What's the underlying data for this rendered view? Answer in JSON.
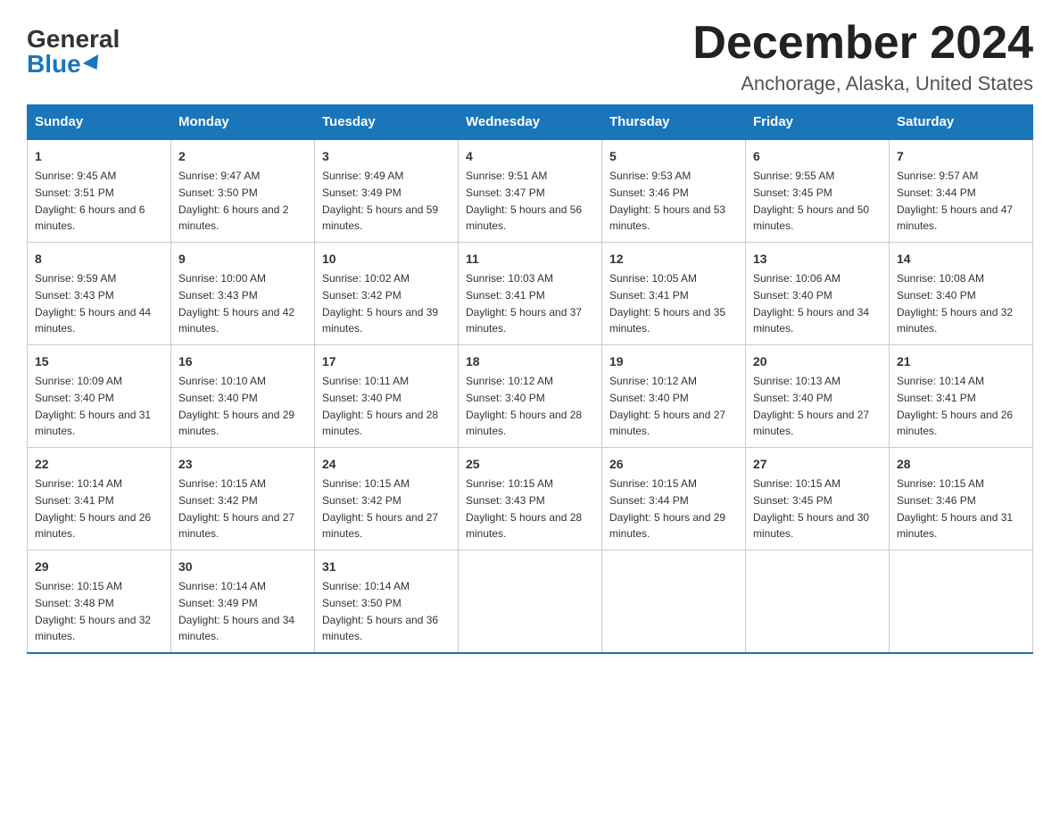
{
  "logo": {
    "general": "General",
    "blue": "Blue"
  },
  "title": "December 2024",
  "location": "Anchorage, Alaska, United States",
  "days_of_week": [
    "Sunday",
    "Monday",
    "Tuesday",
    "Wednesday",
    "Thursday",
    "Friday",
    "Saturday"
  ],
  "weeks": [
    [
      {
        "day": "1",
        "sunrise": "9:45 AM",
        "sunset": "3:51 PM",
        "daylight": "6 hours and 6 minutes."
      },
      {
        "day": "2",
        "sunrise": "9:47 AM",
        "sunset": "3:50 PM",
        "daylight": "6 hours and 2 minutes."
      },
      {
        "day": "3",
        "sunrise": "9:49 AM",
        "sunset": "3:49 PM",
        "daylight": "5 hours and 59 minutes."
      },
      {
        "day": "4",
        "sunrise": "9:51 AM",
        "sunset": "3:47 PM",
        "daylight": "5 hours and 56 minutes."
      },
      {
        "day": "5",
        "sunrise": "9:53 AM",
        "sunset": "3:46 PM",
        "daylight": "5 hours and 53 minutes."
      },
      {
        "day": "6",
        "sunrise": "9:55 AM",
        "sunset": "3:45 PM",
        "daylight": "5 hours and 50 minutes."
      },
      {
        "day": "7",
        "sunrise": "9:57 AM",
        "sunset": "3:44 PM",
        "daylight": "5 hours and 47 minutes."
      }
    ],
    [
      {
        "day": "8",
        "sunrise": "9:59 AM",
        "sunset": "3:43 PM",
        "daylight": "5 hours and 44 minutes."
      },
      {
        "day": "9",
        "sunrise": "10:00 AM",
        "sunset": "3:43 PM",
        "daylight": "5 hours and 42 minutes."
      },
      {
        "day": "10",
        "sunrise": "10:02 AM",
        "sunset": "3:42 PM",
        "daylight": "5 hours and 39 minutes."
      },
      {
        "day": "11",
        "sunrise": "10:03 AM",
        "sunset": "3:41 PM",
        "daylight": "5 hours and 37 minutes."
      },
      {
        "day": "12",
        "sunrise": "10:05 AM",
        "sunset": "3:41 PM",
        "daylight": "5 hours and 35 minutes."
      },
      {
        "day": "13",
        "sunrise": "10:06 AM",
        "sunset": "3:40 PM",
        "daylight": "5 hours and 34 minutes."
      },
      {
        "day": "14",
        "sunrise": "10:08 AM",
        "sunset": "3:40 PM",
        "daylight": "5 hours and 32 minutes."
      }
    ],
    [
      {
        "day": "15",
        "sunrise": "10:09 AM",
        "sunset": "3:40 PM",
        "daylight": "5 hours and 31 minutes."
      },
      {
        "day": "16",
        "sunrise": "10:10 AM",
        "sunset": "3:40 PM",
        "daylight": "5 hours and 29 minutes."
      },
      {
        "day": "17",
        "sunrise": "10:11 AM",
        "sunset": "3:40 PM",
        "daylight": "5 hours and 28 minutes."
      },
      {
        "day": "18",
        "sunrise": "10:12 AM",
        "sunset": "3:40 PM",
        "daylight": "5 hours and 28 minutes."
      },
      {
        "day": "19",
        "sunrise": "10:12 AM",
        "sunset": "3:40 PM",
        "daylight": "5 hours and 27 minutes."
      },
      {
        "day": "20",
        "sunrise": "10:13 AM",
        "sunset": "3:40 PM",
        "daylight": "5 hours and 27 minutes."
      },
      {
        "day": "21",
        "sunrise": "10:14 AM",
        "sunset": "3:41 PM",
        "daylight": "5 hours and 26 minutes."
      }
    ],
    [
      {
        "day": "22",
        "sunrise": "10:14 AM",
        "sunset": "3:41 PM",
        "daylight": "5 hours and 26 minutes."
      },
      {
        "day": "23",
        "sunrise": "10:15 AM",
        "sunset": "3:42 PM",
        "daylight": "5 hours and 27 minutes."
      },
      {
        "day": "24",
        "sunrise": "10:15 AM",
        "sunset": "3:42 PM",
        "daylight": "5 hours and 27 minutes."
      },
      {
        "day": "25",
        "sunrise": "10:15 AM",
        "sunset": "3:43 PM",
        "daylight": "5 hours and 28 minutes."
      },
      {
        "day": "26",
        "sunrise": "10:15 AM",
        "sunset": "3:44 PM",
        "daylight": "5 hours and 29 minutes."
      },
      {
        "day": "27",
        "sunrise": "10:15 AM",
        "sunset": "3:45 PM",
        "daylight": "5 hours and 30 minutes."
      },
      {
        "day": "28",
        "sunrise": "10:15 AM",
        "sunset": "3:46 PM",
        "daylight": "5 hours and 31 minutes."
      }
    ],
    [
      {
        "day": "29",
        "sunrise": "10:15 AM",
        "sunset": "3:48 PM",
        "daylight": "5 hours and 32 minutes."
      },
      {
        "day": "30",
        "sunrise": "10:14 AM",
        "sunset": "3:49 PM",
        "daylight": "5 hours and 34 minutes."
      },
      {
        "day": "31",
        "sunrise": "10:14 AM",
        "sunset": "3:50 PM",
        "daylight": "5 hours and 36 minutes."
      },
      null,
      null,
      null,
      null
    ]
  ],
  "labels": {
    "sunrise": "Sunrise:",
    "sunset": "Sunset:",
    "daylight": "Daylight:"
  }
}
